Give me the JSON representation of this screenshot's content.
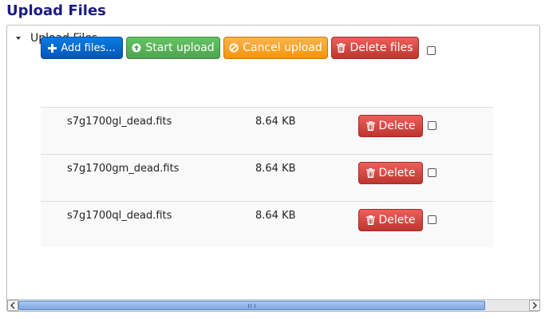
{
  "page": {
    "title": "Upload Files"
  },
  "panel": {
    "header": "Upload Files"
  },
  "toolbar": {
    "add_label": "Add files...",
    "start_label": "Start upload",
    "cancel_label": "Cancel upload",
    "delete_label": "Delete files"
  },
  "files": [
    {
      "name": "s7g1700gl_dead.fits",
      "size": "8.64 KB",
      "delete_label": "Delete"
    },
    {
      "name": "s7g1700gm_dead.fits",
      "size": "8.64 KB",
      "delete_label": "Delete"
    },
    {
      "name": "s7g1700ql_dead.fits",
      "size": "8.64 KB",
      "delete_label": "Delete"
    }
  ],
  "colors": {
    "title": "#1b1b7f",
    "primary": "#0a6fd6",
    "success": "#5cb85c",
    "warning": "#f89406",
    "danger": "#d9534f"
  },
  "icons": {
    "add": "plus-icon",
    "start": "circle-arrow-up-icon",
    "cancel": "ban-circle-icon",
    "delete": "trash-icon",
    "collapse": "caret-down-icon"
  }
}
